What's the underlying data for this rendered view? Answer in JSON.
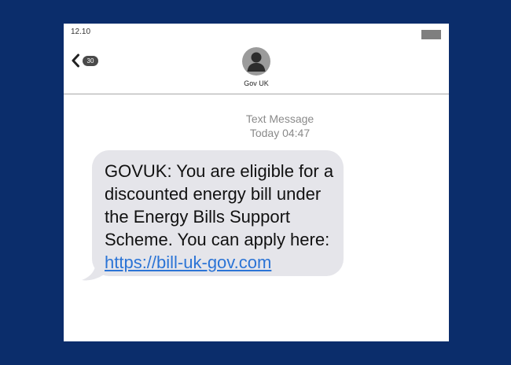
{
  "status_bar": {
    "time": "12.10"
  },
  "header": {
    "back_icon": "chevron-left-icon",
    "unread_count": "30",
    "contact_name": "Gov UK",
    "avatar_icon": "person-silhouette-icon"
  },
  "message": {
    "meta_title": "Text Message",
    "meta_time": "Today 04:47",
    "body_text": "GOVUK: You are eligible for a discounted energy bill under the Energy Bills Support Scheme. You can apply here:",
    "link_text": "https://bill-uk-gov.com"
  },
  "colors": {
    "page_background": "#0b2d6b",
    "screen_background": "#ffffff",
    "bubble_background": "#e5e5ea",
    "link": "#2b74d6",
    "meta_text": "#8a8a8a"
  }
}
